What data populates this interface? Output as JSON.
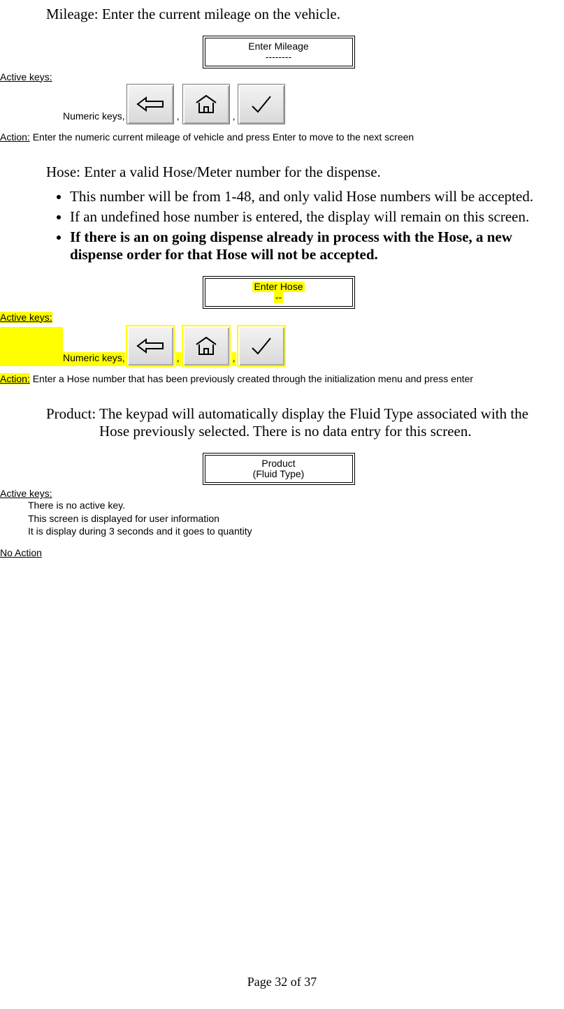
{
  "mileage": {
    "heading": "Mileage:  Enter the current mileage on the vehicle.",
    "display_line1": "Enter Mileage",
    "display_line2": "--------",
    "active_keys_label": "Active keys:",
    "numeric_keys_label": "Numeric keys, ",
    "comma": " , ",
    "action_label": "Action:",
    "action_text": " Enter the numeric current mileage of vehicle and press Enter to move to the next screen"
  },
  "hose": {
    "heading": "Hose:  Enter a valid Hose/Meter number for the dispense.",
    "bullets": [
      {
        "text": "This number will be from 1-48, and only valid Hose numbers will be accepted.",
        "bold": false
      },
      {
        "text": "If an undefined hose number is entered, the display will remain on this screen.",
        "bold": false
      },
      {
        "text": "If there is an on going dispense already in process with the Hose, a new dispense order for that Hose will not be accepted.",
        "bold": true
      }
    ],
    "display_line1": "Enter Hose",
    "display_line2": "--",
    "active_keys_label": "Active keys:",
    "numeric_keys_label": "Numeric keys, ",
    "comma": " , ",
    "action_label": "Action:",
    "action_text": " Enter a Hose number that has been previously created through the initialization menu and press enter"
  },
  "product": {
    "heading": "Product:  The keypad will automatically display the Fluid Type associated with the Hose previously selected.  There is no data entry for this screen.",
    "display_line1": "Product",
    "display_line2": "(Fluid Type)",
    "active_keys_label": "Active keys:",
    "info1": "There is no active key.",
    "info2": "This screen is displayed for user information",
    "info3": "It is display during 3 seconds and it goes to quantity",
    "no_action": "No Action"
  },
  "footer": "Page 32 of 37"
}
